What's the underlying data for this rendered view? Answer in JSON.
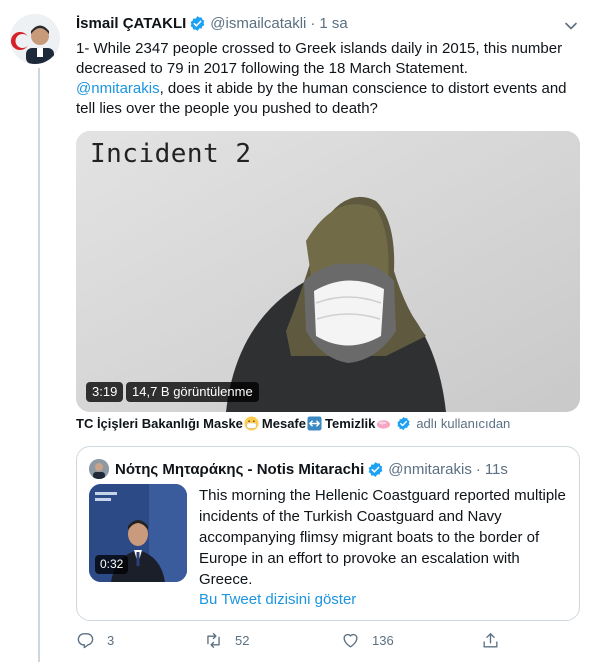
{
  "tweet": {
    "author_name": "İsmail ÇATAKLI",
    "handle": "@ismailcatakli",
    "separator": "·",
    "time": "1 sa",
    "text_line1": "1- While  2347 people crossed to Greek islands daily in 2015, this number decreased to 79 in 2017 following the 18 March Statement.",
    "mention": "@nmitarakis",
    "text_line2": ", does it abide by the human conscience to distort events and tell lies over the people you pushed to death?"
  },
  "video": {
    "title": "Incident 2",
    "duration": "3:19",
    "views": "14,7 B görüntülenme"
  },
  "attribution": {
    "source": "TC İçişleri Bakanlığı Maske",
    "part2": "Mesafe",
    "part3": "Temizlik",
    "tail": "adlı kullanıcıdan"
  },
  "quoted_tweet": {
    "author_name": "Νότης Μηταράκης - Notis Mitarachi",
    "handle": "@nmitarakis",
    "separator": "·",
    "time": "11s",
    "text": "This morning the Hellenic Coastguard reported multiple incidents of the Turkish Coastguard and Navy accompanying flimsy migrant boats to the border of Europe in an effort to provoke an escalation with Greece.",
    "video_duration": "0:32",
    "show_thread": "Bu Tweet dizisini göster"
  },
  "actions": {
    "reply_count": "3",
    "retweet_count": "52",
    "like_count": "136"
  },
  "colors": {
    "link": "#1b95e0",
    "secondary_text": "#5b7083",
    "verified": "#1da1f2"
  },
  "icons": [
    "verified-badge-icon",
    "chevron-down-icon",
    "mask-emoji-icon",
    "left-right-arrow-emoji-icon",
    "soap-emoji-icon",
    "reply-icon",
    "retweet-icon",
    "like-icon",
    "share-icon"
  ]
}
